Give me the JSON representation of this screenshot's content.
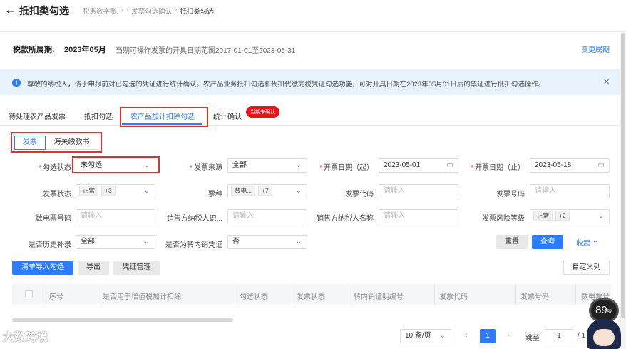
{
  "header": {
    "title": "抵扣类勾选",
    "breadcrumbs": [
      "税务数字账户",
      "发票勾选确认",
      "抵扣类勾选"
    ]
  },
  "period": {
    "label": "税款所属期:",
    "value": "2023年05月",
    "desc": "当期可操作发票的开具日期范围2017-01-01至2023-05-31",
    "change_link": "变更属期"
  },
  "notice": {
    "text": "尊敬的纳税人，请于申报前对已勾选的凭证进行统计确认。农产品业务抵扣勾选和代扣代缴完税凭证勾选功能，可对开具日期在2023年05月01日后的票证进行抵扣勾选操作。"
  },
  "tabs": [
    "待处理农产品发票",
    "抵扣勾选",
    "农产品加计扣除勾选",
    "统计确认"
  ],
  "tab_badge": "当期未确认",
  "subtabs": [
    "发票",
    "海关缴款书"
  ],
  "form": {
    "check_status": {
      "label": "勾选状态",
      "value": "未勾选"
    },
    "invoice_source": {
      "label": "发票来源",
      "value": "全部"
    },
    "date_start": {
      "label": "开票日期（起）",
      "value": "2023-05-01"
    },
    "date_end": {
      "label": "开票日期（止）",
      "value": "2023-05-18"
    },
    "invoice_status": {
      "label": "发票状态",
      "tag": "正常",
      "more": "+3"
    },
    "invoice_type": {
      "label": "票种",
      "tag": "数电...",
      "more": "+7"
    },
    "invoice_code": {
      "label": "发票代码",
      "placeholder": "请输入"
    },
    "invoice_number": {
      "label": "发票号码",
      "placeholder": "请输入"
    },
    "e_invoice_number": {
      "label": "数电票号码",
      "placeholder": "请输入"
    },
    "seller_tax_id": {
      "label": "销售方纳税人识...",
      "placeholder": "请输入"
    },
    "seller_name": {
      "label": "销售方纳税人名称",
      "placeholder": "请输入"
    },
    "risk_level": {
      "label": "发票风险等级",
      "tag": "正常",
      "more": "+2"
    },
    "history_supplement": {
      "label": "是否历史补录",
      "value": "全部"
    },
    "transfer_out": {
      "label": "是否为转内销凭证",
      "value": "否"
    }
  },
  "actions": {
    "reset": "重置",
    "query": "查询",
    "collapse": "收起",
    "import_check": "清单导入勾选",
    "export": "导出",
    "voucher_mgmt": "凭证管理",
    "custom_columns": "自定义列"
  },
  "table": {
    "columns": [
      "序号",
      "是否用于增值税加计扣除",
      "勾选状态",
      "发票状态",
      "转内销证明编号",
      "发票代码",
      "发票号码",
      "数电票号"
    ]
  },
  "pagination": {
    "page_size": "10 条/页",
    "current": "1",
    "jump_label": "跳至",
    "jump_value": "1",
    "total": "/ 1"
  },
  "overlay": {
    "watermark": "大数跨境",
    "gauge": "89",
    "gauge_unit": "%"
  },
  "colors": {
    "accent": "#2d7cff",
    "highlight_box": "#e03131",
    "badge": "#e8141b"
  }
}
